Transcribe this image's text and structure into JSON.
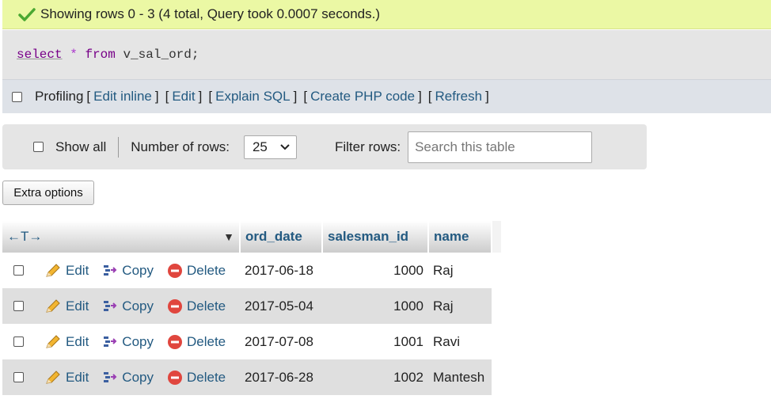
{
  "message": {
    "text": "Showing rows 0 - 3 (4 total, Query took 0.0007 seconds.)"
  },
  "sql": {
    "select": "select",
    "star": "*",
    "from": "from",
    "rest": "v_sal_ord;"
  },
  "toolbar": {
    "profiling": "Profiling",
    "edit_inline": "Edit inline",
    "edit": "Edit",
    "explain": "Explain SQL",
    "create_php": "Create PHP code",
    "refresh": "Refresh",
    "open": "[",
    "close": "]"
  },
  "nav": {
    "show_all": "Show all",
    "num_rows_label": "Number of rows:",
    "num_rows_value": "25",
    "filter_label": "Filter rows:",
    "search_placeholder": "Search this table"
  },
  "extra_options": "Extra options",
  "table": {
    "resize_arrows": "←T→",
    "sort_marker": "▼",
    "columns": [
      "ord_date",
      "salesman_id",
      "name"
    ],
    "action_labels": {
      "edit": "Edit",
      "copy": "Copy",
      "delete": "Delete"
    },
    "rows": [
      {
        "ord_date": "2017-06-18",
        "salesman_id": "1000",
        "name": "Raj"
      },
      {
        "ord_date": "2017-05-04",
        "salesman_id": "1000",
        "name": "Raj"
      },
      {
        "ord_date": "2017-07-08",
        "salesman_id": "1001",
        "name": "Ravi"
      },
      {
        "ord_date": "2017-06-28",
        "salesman_id": "1002",
        "name": "Mantesh"
      }
    ]
  },
  "colors": {
    "link": "#235a81",
    "success_bg": "#ebf8a4",
    "delete_red": "#e0463e",
    "check_green": "#4aa832"
  }
}
